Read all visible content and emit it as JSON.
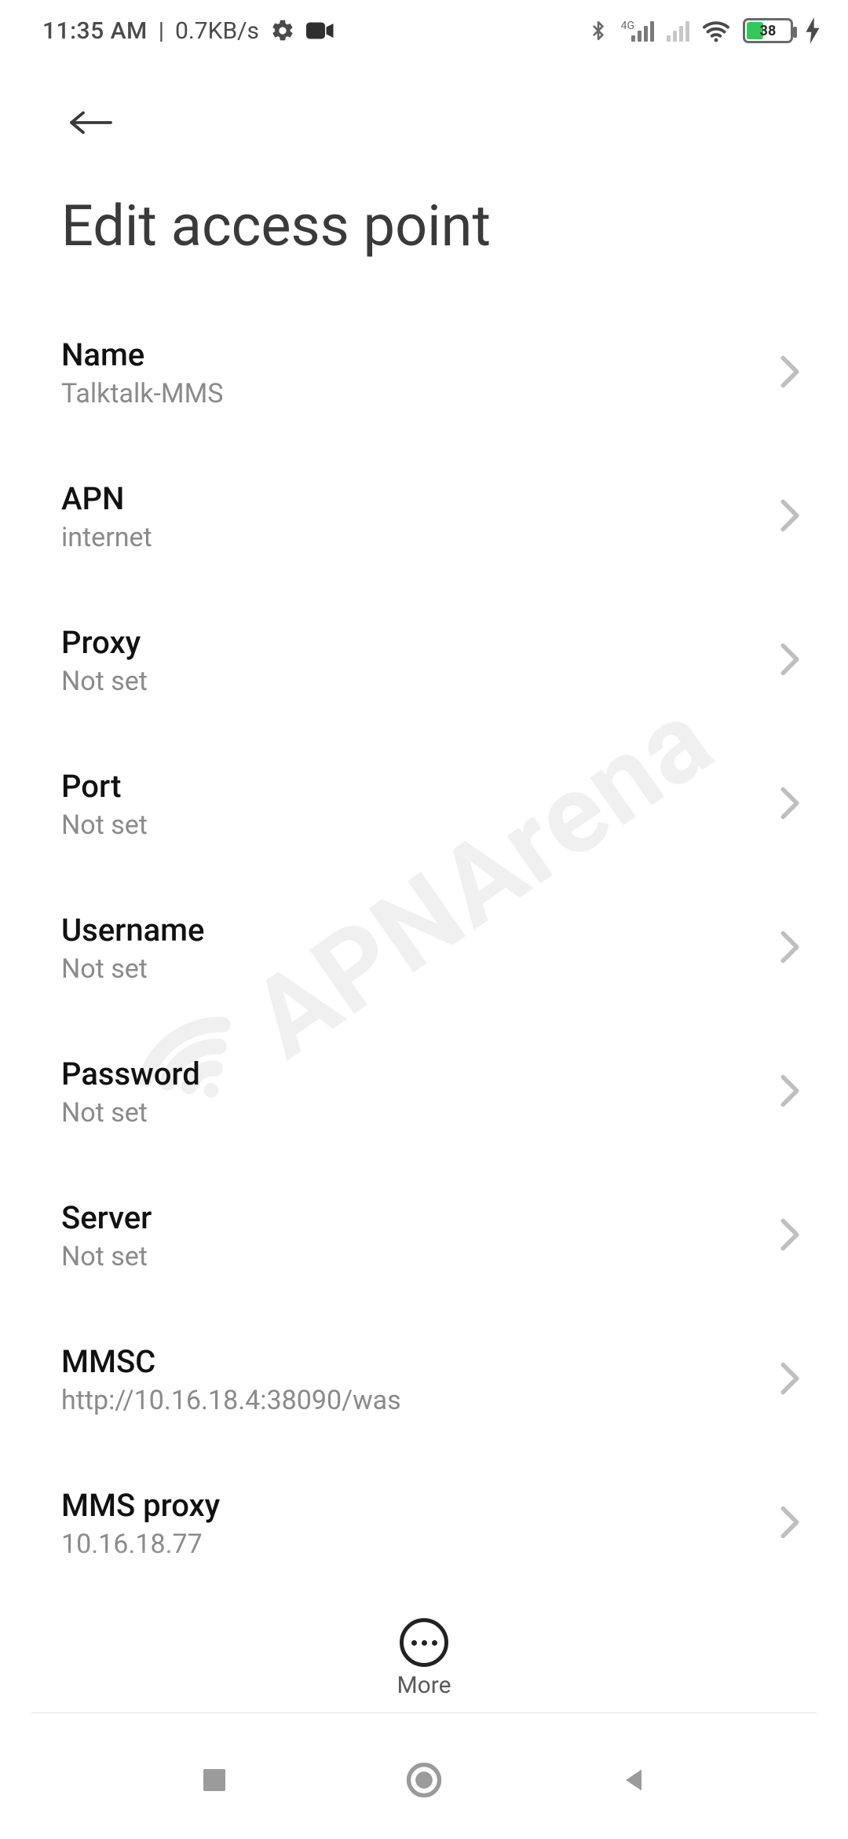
{
  "status": {
    "time": "11:35 AM",
    "separator": "|",
    "network_speed": "0.7KB/s",
    "signal_label_4g": "4G",
    "battery_percent": 38
  },
  "header": {
    "title": "Edit access point"
  },
  "settings": [
    {
      "title": "Name",
      "value": "Talktalk-MMS"
    },
    {
      "title": "APN",
      "value": "internet"
    },
    {
      "title": "Proxy",
      "value": "Not set"
    },
    {
      "title": "Port",
      "value": "Not set"
    },
    {
      "title": "Username",
      "value": "Not set"
    },
    {
      "title": "Password",
      "value": "Not set"
    },
    {
      "title": "Server",
      "value": "Not set"
    },
    {
      "title": "MMSC",
      "value": "http://10.16.18.4:38090/was"
    },
    {
      "title": "MMS proxy",
      "value": "10.16.18.77"
    }
  ],
  "actions": {
    "more_label": "More"
  },
  "watermark": {
    "text": "APNArena"
  }
}
